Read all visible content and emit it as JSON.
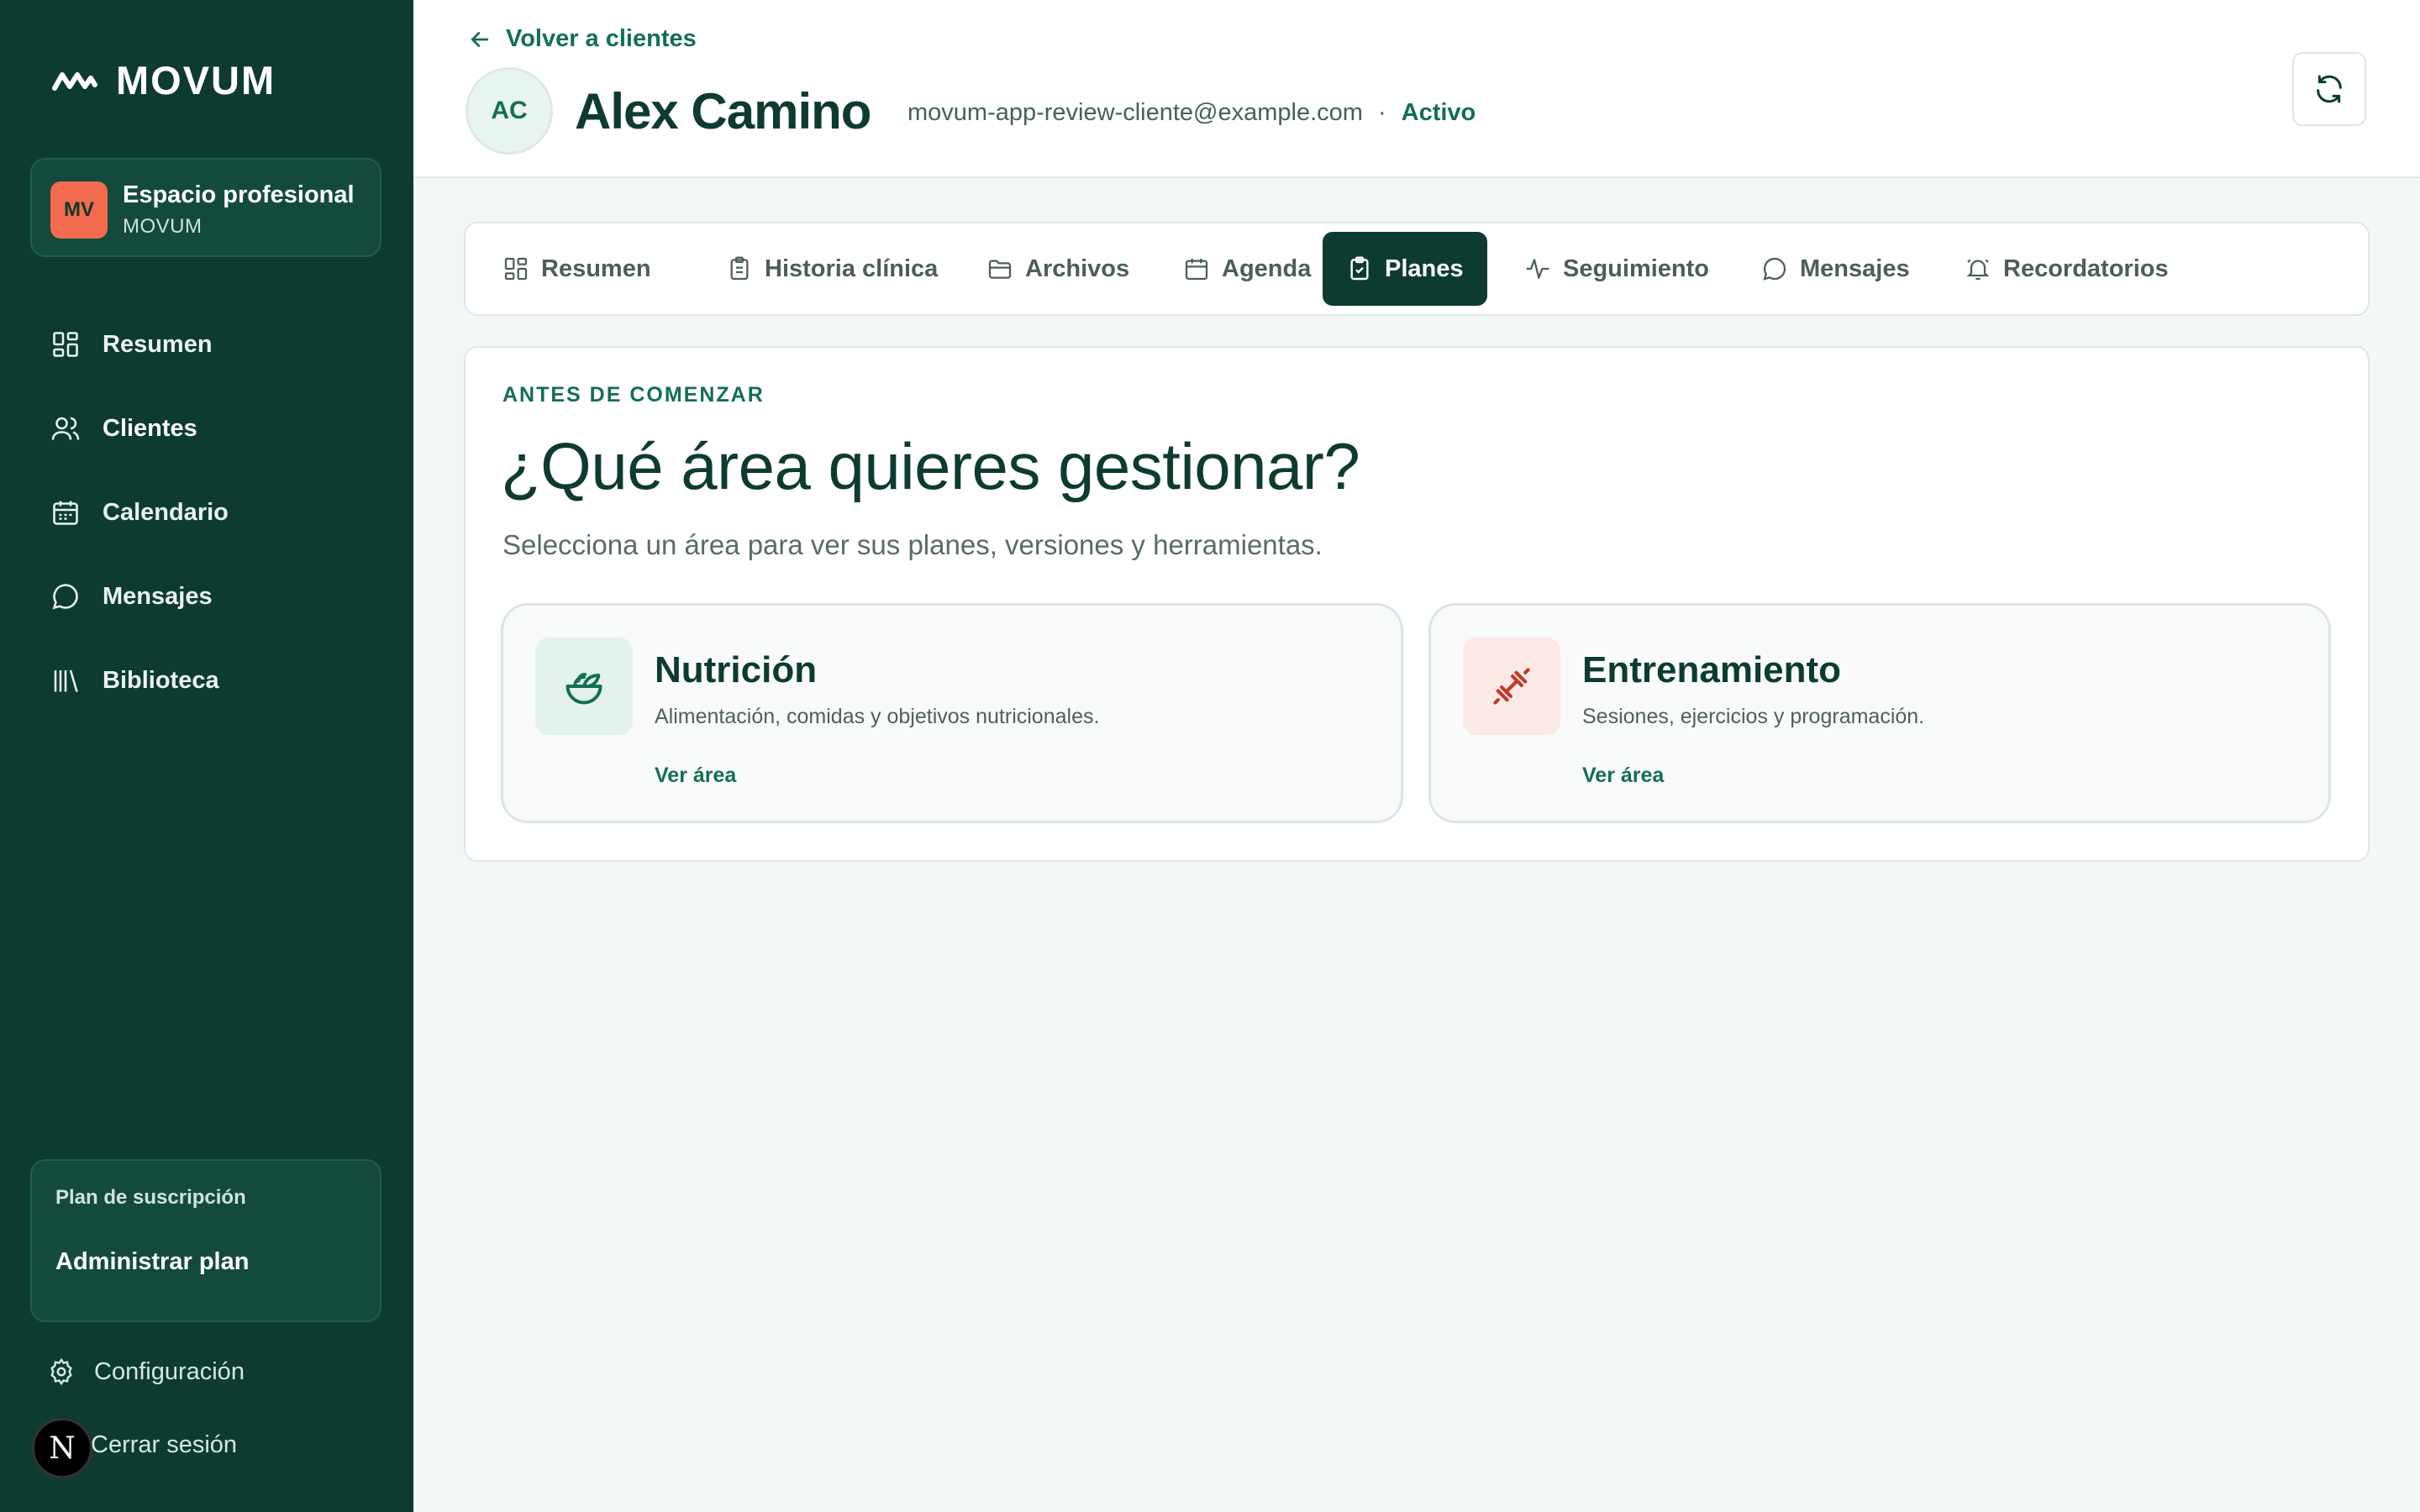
{
  "brand": {
    "name": "MOVUM"
  },
  "workspace": {
    "initials": "MV",
    "title": "Espacio profesional",
    "subtitle": "MOVUM"
  },
  "nav": {
    "items": [
      {
        "label": "Resumen",
        "icon": "dashboard-icon"
      },
      {
        "label": "Clientes",
        "icon": "users-icon",
        "active": true
      },
      {
        "label": "Calendario",
        "icon": "calendar-icon"
      },
      {
        "label": "Mensajes",
        "icon": "message-icon"
      },
      {
        "label": "Biblioteca",
        "icon": "library-icon"
      }
    ]
  },
  "plan": {
    "title": "Plan de suscripción",
    "link": "Administrar plan"
  },
  "footer": {
    "settings": "Configuración",
    "logout": "Cerrar sesión",
    "badge": "N"
  },
  "header": {
    "back": "Volver a clientes",
    "initials": "AC",
    "name": "Alex Camino",
    "email": "movum-app-review-cliente@example.com",
    "separator": "·",
    "status": "Activo"
  },
  "tabs": [
    {
      "label": "Resumen",
      "icon": "dashboard-icon"
    },
    {
      "label": "Historia clínica",
      "icon": "clipboard-icon"
    },
    {
      "label": "Archivos",
      "icon": "folder-icon"
    },
    {
      "label": "Agenda",
      "icon": "calendar-icon"
    },
    {
      "label": "Planes",
      "icon": "clipboard-check-icon",
      "active": true
    },
    {
      "label": "Seguimiento",
      "icon": "activity-icon"
    },
    {
      "label": "Mensajes",
      "icon": "message-icon"
    },
    {
      "label": "Recordatorios",
      "icon": "bell-icon"
    }
  ],
  "main": {
    "eyebrow": "ANTES DE COMENZAR",
    "headline": "¿Qué área quieres gestionar?",
    "subline": "Selecciona un área para ver sus planes, versiones y herramientas.",
    "areas": [
      {
        "title": "Nutrición",
        "description": "Alimentación, comidas y objetivos nutricionales.",
        "link": "Ver área",
        "icon": "salad-icon"
      },
      {
        "title": "Entrenamiento",
        "description": "Sesiones, ejercicios y programación.",
        "link": "Ver área",
        "icon": "dumbbell-icon"
      }
    ]
  },
  "colors": {
    "sidebar": "#0d3b32",
    "accent": "#13704f",
    "orange": "#f26b4e",
    "training": "#c0392b"
  }
}
